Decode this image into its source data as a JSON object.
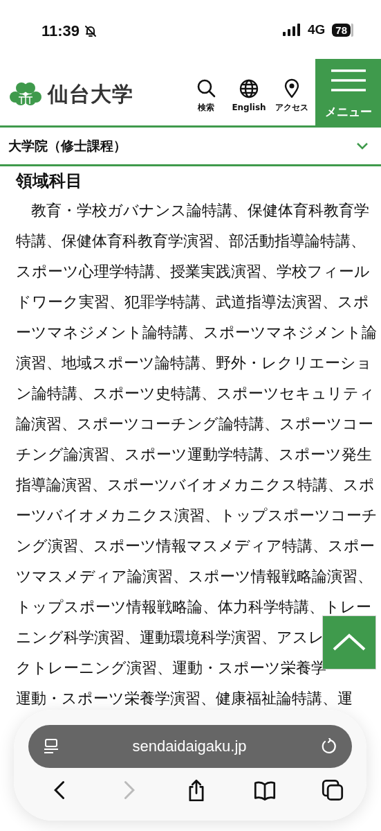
{
  "status_bar": {
    "time": "11:39",
    "network": "4G",
    "battery": "78"
  },
  "header": {
    "logo_text": "仙台大学",
    "nav": [
      {
        "label": "検索",
        "kind": "search"
      },
      {
        "label": "English",
        "kind": "globe"
      },
      {
        "label": "アクセス",
        "kind": "pin"
      }
    ],
    "menu_label": "メニュー"
  },
  "breadcrumb": {
    "label": "大学院（修士課程）",
    "expanded": false
  },
  "section": {
    "heading": "領域科目",
    "lines": [
      "教育・学校ガバナンス論特講、保健体育科教育学",
      "特講、保健体育科教育学演習、部活動指導論特講、",
      "スポーツ心理学特講、授業実践演習、学校フィール",
      "ドワーク実習、犯罪学特講、武道指導法演習、スポ",
      "ーツマネジメント論特講、スポーツマネジメント論",
      "演習、地域スポーツ論特講、野外・レクリエーショ",
      "ン論特講、スポーツ史特講、スポーツセキュリティ",
      "論演習、スポーツコーチング論特講、スポーツコー",
      "チング論演習、スポーツ運動学特講、スポーツ発生",
      "指導論演習、スポーツバイオメカニクス特講、スポ",
      "ーツバイオメカニクス演習、トップスポーツコーチ",
      "ング演習、スポーツ情報マスメディア特講、スポー",
      "ツマスメディア論演習、スポーツ情報戦略論演習、",
      "トップスポーツ情報戦略論、体力科学特講、トレー",
      "ニング科学演習、運動環境科学演習、アスレ",
      "クトレーニング演習、運動・スポーツ栄養学",
      "運動・スポーツ栄養学演習、健康福祉論特講、運"
    ]
  },
  "browser": {
    "url": "sendaidaigaku.jp",
    "buttons": [
      {
        "kind": "back",
        "disabled": false
      },
      {
        "kind": "forward",
        "disabled": true
      },
      {
        "kind": "share",
        "disabled": false
      },
      {
        "kind": "bookmarks",
        "disabled": false
      },
      {
        "kind": "tabs",
        "disabled": false
      }
    ]
  }
}
